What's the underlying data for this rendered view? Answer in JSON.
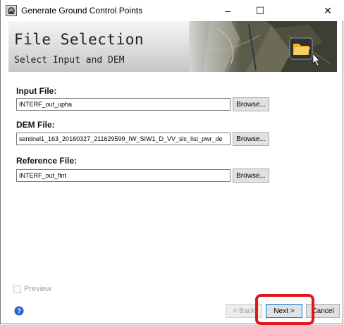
{
  "window": {
    "title": "Generate Ground Control Points",
    "controls": {
      "minimize": "–",
      "maximize": "☐",
      "close": "✕"
    }
  },
  "banner": {
    "title": "File Selection",
    "subtitle": "Select Input and DEM",
    "icon": "folder-icon"
  },
  "form": {
    "input_file": {
      "label": "Input File:",
      "value": "INTERF_out_upha",
      "browse_label": "Browse..."
    },
    "dem_file": {
      "label": "DEM File:",
      "value": "sentinel1_163_20160327_211629599_IW_SIW1_D_VV_slc_list_pwr_de",
      "browse_label": "Browse..."
    },
    "reference_file": {
      "label": "Reference File:",
      "value": "INTERF_out_fint",
      "browse_label": "Browse..."
    }
  },
  "footer": {
    "preview_label": "Preview",
    "help_icon": "help-icon",
    "back_label": "< Back",
    "next_label": "Next >",
    "cancel_label": "Cancel"
  },
  "colors": {
    "highlight": "#e3141c",
    "help_blue": "#2c5fd0",
    "focus_border": "#0078d7"
  }
}
